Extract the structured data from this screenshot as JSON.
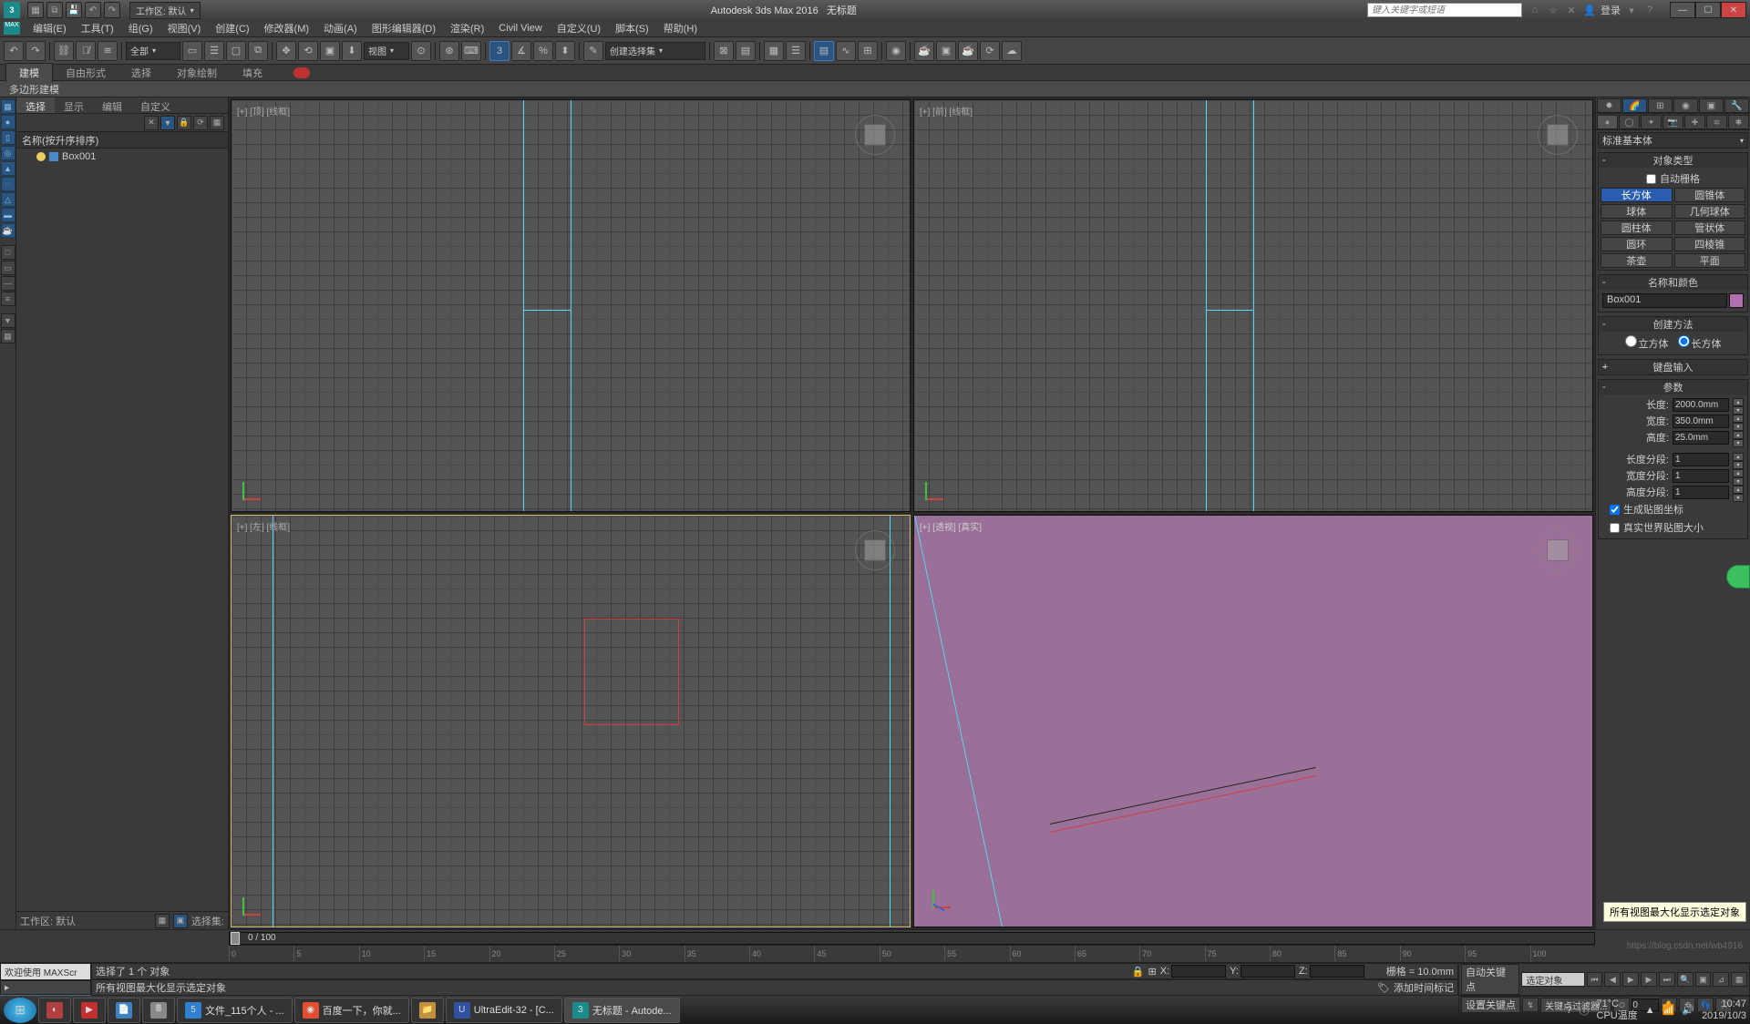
{
  "app": {
    "title": "Autodesk 3ds Max 2016",
    "doc": "无标题",
    "workspace_label": "工作区: 默认",
    "login": "登录",
    "search_placeholder": "键入关键字或短语"
  },
  "menu": [
    "编辑(E)",
    "工具(T)",
    "组(G)",
    "视图(V)",
    "创建(C)",
    "修改器(M)",
    "动画(A)",
    "图形编辑器(D)",
    "渲染(R)",
    "Civil View",
    "自定义(U)",
    "脚本(S)",
    "帮助(H)"
  ],
  "toolbar": {
    "filter": "全部",
    "refsys": "视图",
    "selset": "创建选择集"
  },
  "ribbon": {
    "tabs": [
      "建模",
      "自由形式",
      "选择",
      "对象绘制",
      "填充"
    ],
    "sub": "多边形建模"
  },
  "scene": {
    "tabs": [
      "选择",
      "显示",
      "编辑",
      "自定义"
    ],
    "sort_header": "名称(按升序排序)",
    "items": [
      {
        "name": "Box001"
      }
    ],
    "footer_ws": "工作区: 默认",
    "footer_sel": "选择集:"
  },
  "viewports": {
    "top": "[+] [顶] [线框]",
    "front": "[+] [前] [线框]",
    "left": "[+] [左] [线框]",
    "persp": "[+] [透视] [真实]"
  },
  "cmd": {
    "category": "标准基本体",
    "rollouts": {
      "objtype": "对象类型",
      "autogrid": "自动栅格",
      "prims": [
        "长方体",
        "圆锥体",
        "球体",
        "几何球体",
        "圆柱体",
        "管状体",
        "圆环",
        "四棱锥",
        "茶壶",
        "平面"
      ],
      "namecolor": "名称和颜色",
      "name": "Box001",
      "method": "创建方法",
      "method_opts": [
        "立方体",
        "长方体"
      ],
      "kbd": "键盘输入",
      "params": "参数",
      "length_l": "长度:",
      "length_v": "2000.0mm",
      "width_l": "宽度:",
      "width_v": "350.0mm",
      "height_l": "高度:",
      "height_v": "25.0mm",
      "lsegs_l": "长度分段:",
      "lsegs_v": "1",
      "wsegs_l": "宽度分段:",
      "wsegs_v": "1",
      "hsegs_l": "高度分段:",
      "hsegs_v": "1",
      "genmap": "生成贴图坐标",
      "realworld": "真实世界贴图大小"
    }
  },
  "timeline": {
    "frameinfo": "0 / 100",
    "ticks": [
      "0",
      "5",
      "10",
      "15",
      "20",
      "25",
      "30",
      "35",
      "40",
      "45",
      "50",
      "55",
      "60",
      "65",
      "70",
      "75",
      "80",
      "85",
      "90",
      "95",
      "100"
    ]
  },
  "status": {
    "welcome": "欢迎使用 MAXScr",
    "sel": "选择了 1 个 对象",
    "prompt": "所有视图最大化显示选定对象",
    "grid": "栅格 = 10.0mm",
    "addtag": "添加时间标记",
    "autokey": "自动关键点",
    "setkey": "设置关键点",
    "keyfilter": "关键点过滤器...",
    "keymode": "选定对象",
    "tooltip": "所有视图最大化显示选定对象",
    "coord_x": "X:",
    "coord_y": "Y:",
    "coord_z": "Z:",
    "spinner_0": "0"
  },
  "taskbar": {
    "tasks": [
      "文件_115个人 - ...",
      "百度一下，你就...",
      "",
      "UltraEdit-32 - [C...",
      "无标题 - Autode..."
    ],
    "temp1": "71°C",
    "temp2": "CPU温度",
    "time": "10:47",
    "date": "2019/10/3",
    "watermark": "https://blog.csdn.net/wb4916"
  }
}
